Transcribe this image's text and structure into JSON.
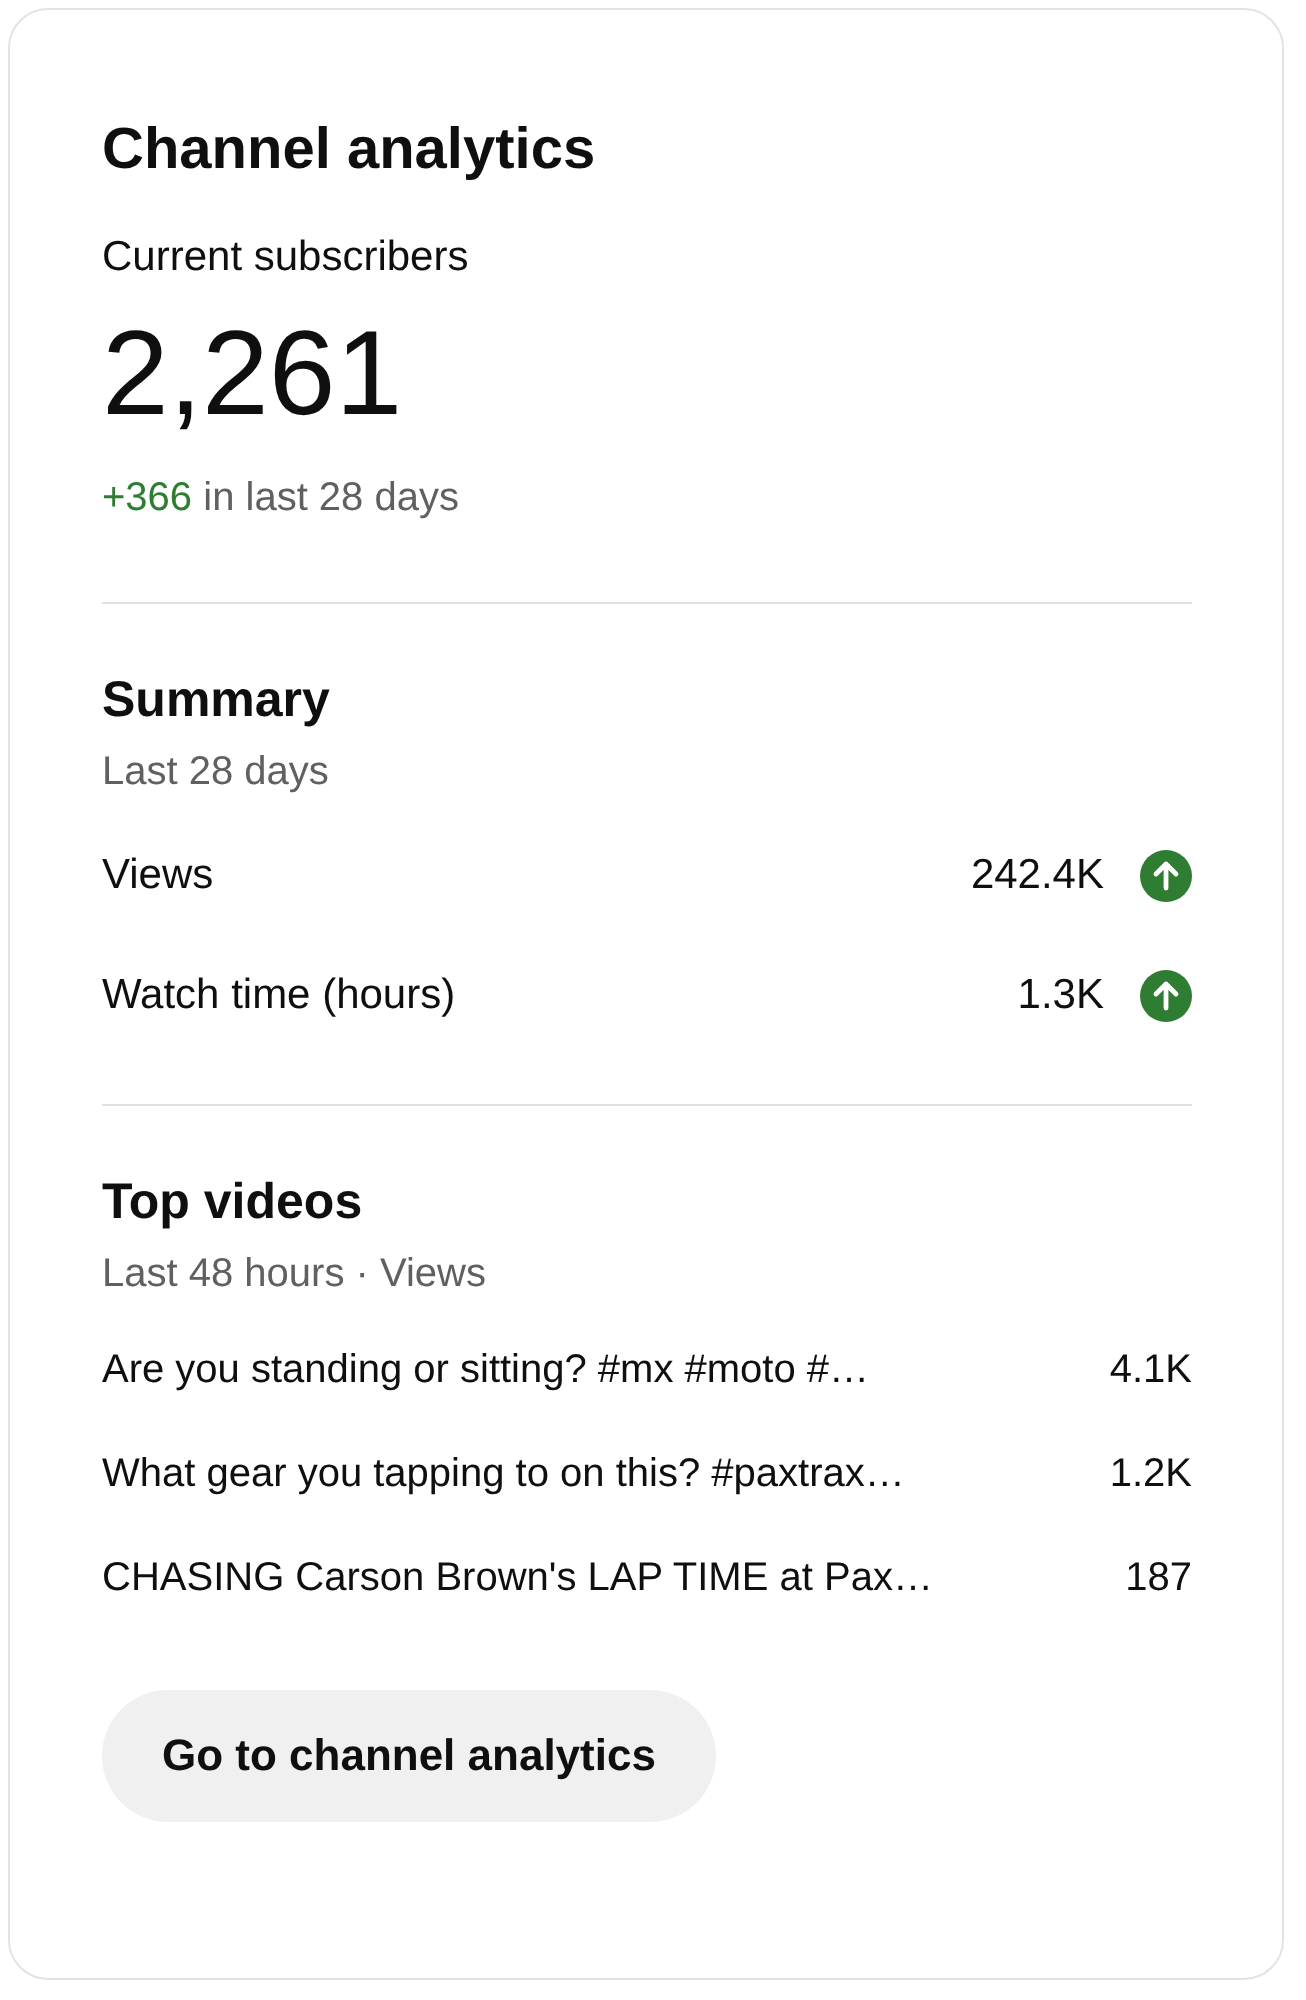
{
  "title": "Channel analytics",
  "subscribers": {
    "label": "Current subscribers",
    "value": "2,261",
    "change": "+366",
    "change_suffix": "in last 28 days"
  },
  "summary": {
    "title": "Summary",
    "period": "Last 28 days",
    "metrics": [
      {
        "label": "Views",
        "value": "242.4K",
        "rising": true
      },
      {
        "label": "Watch time (hours)",
        "value": "1.3K",
        "rising": true
      }
    ]
  },
  "top_videos": {
    "title": "Top videos",
    "period": "Last 48 hours · Views",
    "videos": [
      {
        "title": "Are you standing or sitting? #mx #moto #…",
        "views": "4.1K"
      },
      {
        "title": "What gear you tapping to on this? #paxtrax…",
        "views": "1.2K"
      },
      {
        "title": "CHASING Carson Brown's LAP TIME at Pax…",
        "views": "187"
      }
    ]
  },
  "button": "Go to channel analytics"
}
